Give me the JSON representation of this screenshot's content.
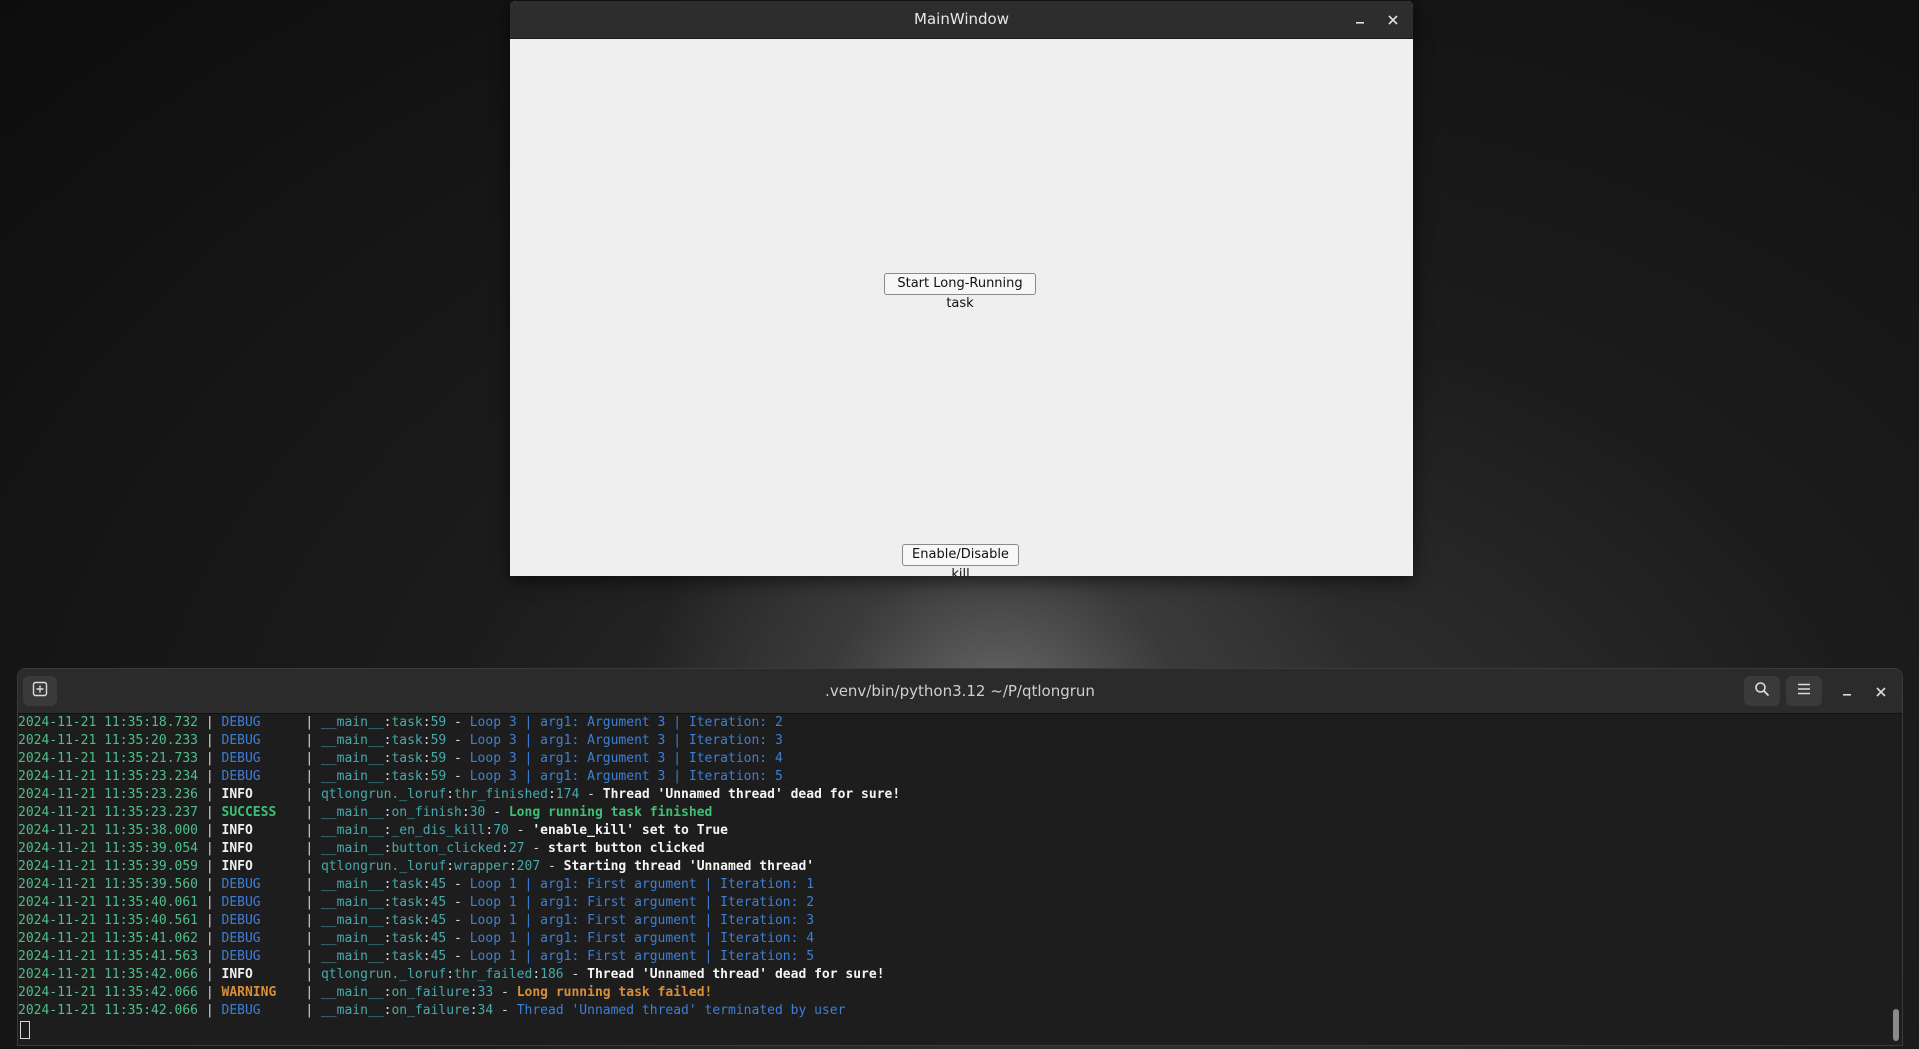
{
  "qt_window": {
    "title": "MainWindow",
    "start_button_label": "Start Long-Running task",
    "kill_button_label": "Enable/Disable kill"
  },
  "terminal": {
    "title": ".venv/bin/python3.12 ~/P/qtlongrun",
    "log": [
      {
        "ts": "2024-11-21 11:35:18.732",
        "level": "DEBUG",
        "module": "__main__",
        "func": "task",
        "line": "59",
        "msg": "Loop 3 | arg1: Argument 3 | Iteration: 2"
      },
      {
        "ts": "2024-11-21 11:35:20.233",
        "level": "DEBUG",
        "module": "__main__",
        "func": "task",
        "line": "59",
        "msg": "Loop 3 | arg1: Argument 3 | Iteration: 3"
      },
      {
        "ts": "2024-11-21 11:35:21.733",
        "level": "DEBUG",
        "module": "__main__",
        "func": "task",
        "line": "59",
        "msg": "Loop 3 | arg1: Argument 3 | Iteration: 4"
      },
      {
        "ts": "2024-11-21 11:35:23.234",
        "level": "DEBUG",
        "module": "__main__",
        "func": "task",
        "line": "59",
        "msg": "Loop 3 | arg1: Argument 3 | Iteration: 5"
      },
      {
        "ts": "2024-11-21 11:35:23.236",
        "level": "INFO",
        "module": "qtlongrun._loruf",
        "func": "thr_finished",
        "line": "174",
        "msg": "Thread 'Unnamed thread' dead for sure!"
      },
      {
        "ts": "2024-11-21 11:35:23.237",
        "level": "SUCCESS",
        "module": "__main__",
        "func": "on_finish",
        "line": "30",
        "msg": "Long running task finished"
      },
      {
        "ts": "2024-11-21 11:35:38.000",
        "level": "INFO",
        "module": "__main__",
        "func": "_en_dis_kill",
        "line": "70",
        "msg": "'enable_kill' set to True"
      },
      {
        "ts": "2024-11-21 11:35:39.054",
        "level": "INFO",
        "module": "__main__",
        "func": "button_clicked",
        "line": "27",
        "msg": "start button clicked"
      },
      {
        "ts": "2024-11-21 11:35:39.059",
        "level": "INFO",
        "module": "qtlongrun._loruf",
        "func": "wrapper",
        "line": "207",
        "msg": "Starting thread 'Unnamed thread'"
      },
      {
        "ts": "2024-11-21 11:35:39.560",
        "level": "DEBUG",
        "module": "__main__",
        "func": "task",
        "line": "45",
        "msg": "Loop 1 | arg1: First argument | Iteration: 1"
      },
      {
        "ts": "2024-11-21 11:35:40.061",
        "level": "DEBUG",
        "module": "__main__",
        "func": "task",
        "line": "45",
        "msg": "Loop 1 | arg1: First argument | Iteration: 2"
      },
      {
        "ts": "2024-11-21 11:35:40.561",
        "level": "DEBUG",
        "module": "__main__",
        "func": "task",
        "line": "45",
        "msg": "Loop 1 | arg1: First argument | Iteration: 3"
      },
      {
        "ts": "2024-11-21 11:35:41.062",
        "level": "DEBUG",
        "module": "__main__",
        "func": "task",
        "line": "45",
        "msg": "Loop 1 | arg1: First argument | Iteration: 4"
      },
      {
        "ts": "2024-11-21 11:35:41.563",
        "level": "DEBUG",
        "module": "__main__",
        "func": "task",
        "line": "45",
        "msg": "Loop 1 | arg1: First argument | Iteration: 5"
      },
      {
        "ts": "2024-11-21 11:35:42.066",
        "level": "INFO",
        "module": "qtlongrun._loruf",
        "func": "thr_failed",
        "line": "186",
        "msg": "Thread 'Unnamed thread' dead for sure!"
      },
      {
        "ts": "2024-11-21 11:35:42.066",
        "level": "WARNING",
        "module": "__main__",
        "func": "on_failure",
        "line": "33",
        "msg": "Long running task failed!"
      },
      {
        "ts": "2024-11-21 11:35:42.066",
        "level": "DEBUG",
        "module": "__main__",
        "func": "on_failure",
        "line": "34",
        "msg": "Thread 'Unnamed thread' terminated by user"
      }
    ]
  },
  "icons": {
    "qt_minimize": "minimize-icon",
    "qt_close": "close-icon",
    "new_tab": "new-tab-icon",
    "search": "search-icon",
    "menu": "hamburger-menu-icon",
    "term_minimize": "minimize-icon",
    "term_close": "close-icon"
  },
  "colors": {
    "timestamp": "#4fbf8a",
    "debug": "#3d7fd6",
    "info": "#f0f0f0",
    "success": "#3fbf75",
    "warning": "#d98e3a",
    "location": "#47a9ac"
  }
}
